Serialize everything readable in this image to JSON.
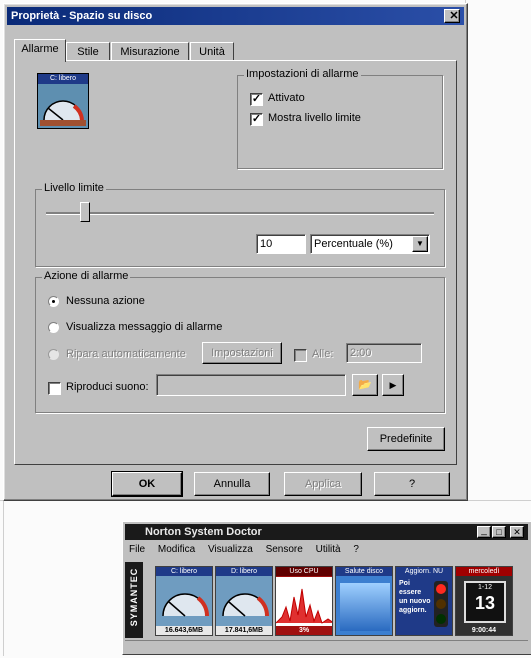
{
  "dialog": {
    "title": "Proprietà - Spazio su disco",
    "close_glyph": "✕",
    "tabs": [
      {
        "label": "Allarme",
        "active": true
      },
      {
        "label": "Stile",
        "active": false
      },
      {
        "label": "Misurazione",
        "active": false
      },
      {
        "label": "Unità",
        "active": false
      }
    ],
    "gauge_icon_label": "C: libero",
    "alarm_settings": {
      "label": "Impostazioni di allarme",
      "activated_label": "Attivato",
      "activated_checked": true,
      "show_limit_label": "Mostra livello limite",
      "show_limit_checked": true
    },
    "limit": {
      "label": "Livello limite",
      "slider_fraction": 0.1,
      "value": "10",
      "unit_selected": "Percentuale (%)"
    },
    "action": {
      "label": "Azione di allarme",
      "options": [
        {
          "label": "Nessuna azione",
          "selected": true,
          "enabled": true
        },
        {
          "label": "Visualizza messaggio di allarme",
          "selected": false,
          "enabled": true
        },
        {
          "label": "Ripara automaticamente",
          "selected": false,
          "enabled": false
        }
      ],
      "settings_button": "Impostazioni",
      "alle_label": "Alle:",
      "alle_value": "2:00",
      "sound_label": "Riproduci suono:",
      "sound_checked": false,
      "sound_value": ""
    },
    "defaults_button": "Predefinite",
    "buttons": {
      "ok": "OK",
      "cancel": "Annulla",
      "apply": "Applica",
      "help": "?"
    }
  },
  "norton": {
    "title": "Norton System Doctor",
    "window_controls": [
      "_",
      "□",
      "✕"
    ],
    "menu": [
      "File",
      "Modifica",
      "Visualizza",
      "Sensore",
      "Utilità",
      "?"
    ],
    "brand": "SYMANTEC",
    "sensors": [
      {
        "caption": "C: libero",
        "value": "16.643,6MB",
        "kind": "gauge"
      },
      {
        "caption": "D: libero",
        "value": "17.841,6MB",
        "kind": "gauge"
      },
      {
        "caption": "Uso CPU",
        "value": "3%",
        "kind": "cpu"
      },
      {
        "caption": "Salute disco",
        "value": "",
        "kind": "disk"
      },
      {
        "caption": "Aggiorn. NU",
        "lines": [
          "Poi",
          "essere",
          "un nuovo",
          "aggiorn."
        ],
        "kind": "traffic"
      },
      {
        "caption": "mercoledì",
        "date_month": "1-12",
        "date_day": "13",
        "time": "9:00:44",
        "kind": "clock"
      }
    ]
  },
  "colors": {
    "title_bar": "#0a2a78",
    "face": "#c0c0c0",
    "norton_dark": "#1a1a1a"
  }
}
